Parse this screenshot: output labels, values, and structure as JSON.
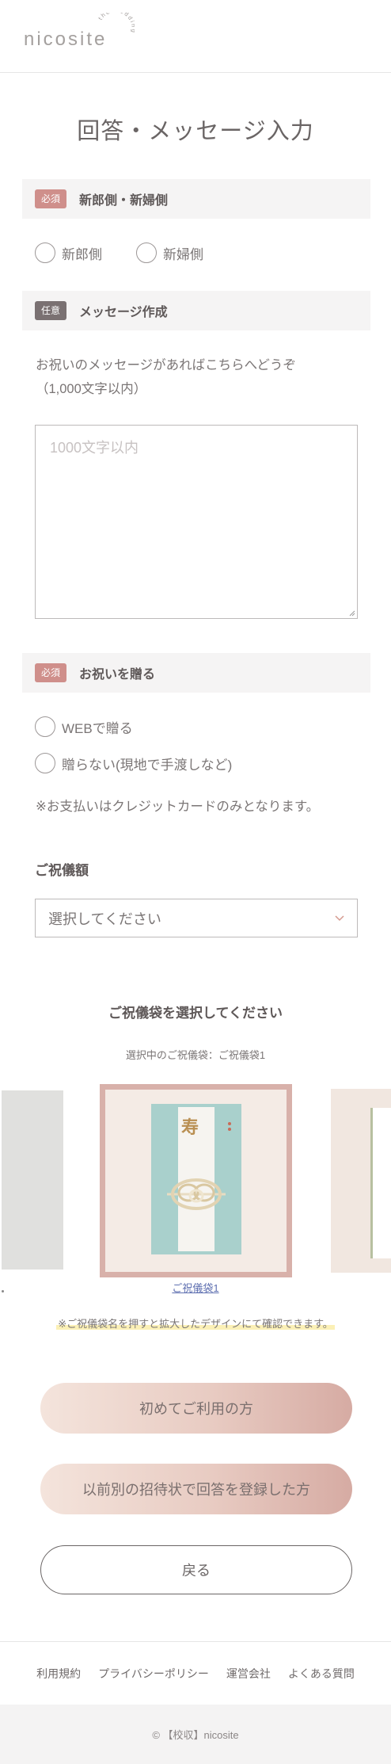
{
  "header": {
    "logo_text": "nicosite",
    "logo_tagline": "the wedding"
  },
  "page": {
    "title": "回答・メッセージ入力"
  },
  "side_section": {
    "badge": "必須",
    "title": "新郎側・新婦側",
    "options": [
      "新郎側",
      "新婦側"
    ]
  },
  "message_section": {
    "badge": "任意",
    "title": "メッセージ作成",
    "note_line1": "お祝いのメッセージがあればこちらへどうぞ",
    "note_line2": "（1,000文字以内）",
    "placeholder": "1000文字以内"
  },
  "gift_section": {
    "badge": "必須",
    "title": "お祝いを贈る",
    "options": [
      "WEBで贈る",
      "贈らない(現地で手渡しなど)"
    ],
    "payment_note": "※お支払いはクレジットカードのみとなります。",
    "amount_label": "ご祝儀額",
    "amount_select": "選択してください"
  },
  "envelope_section": {
    "title": "ご祝儀袋を選択してください",
    "selected_text": "選択中のご祝儀袋：ご祝儀袋1",
    "envelope_glyph": "寿",
    "link_label": "ご祝儀袋1",
    "hint": "※ご祝儀袋名を押すと拡大したデザインにて確認できます。"
  },
  "buttons": {
    "first_use": "初めてご利用の方",
    "previous": "以前別の招待状で回答を登録した方",
    "back": "戻る"
  },
  "footer": {
    "links": [
      "利用規約",
      "プライバシーポリシー",
      "運営会社",
      "よくある質問"
    ],
    "copyright": "© 【校収】nicosite"
  },
  "colors": {
    "required_badge": "#cf8f8b",
    "optional_badge": "#7a7172",
    "button_gradient_start": "#f4e4dc",
    "button_gradient_end": "#d6aba3",
    "envelope_frame": "#d8b1aa",
    "envelope_body": "#a9d0cc"
  }
}
